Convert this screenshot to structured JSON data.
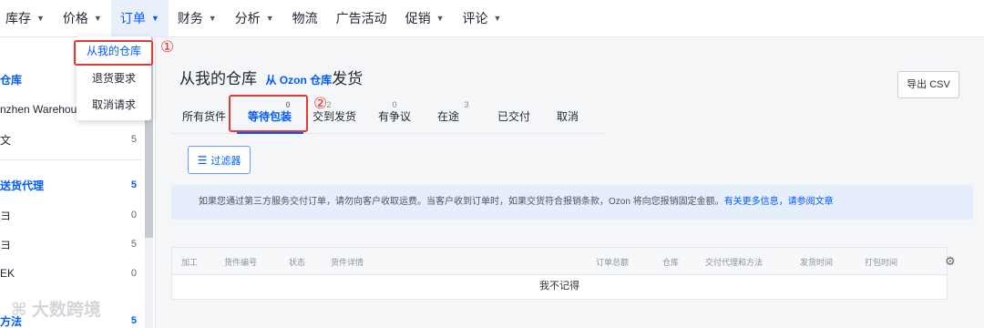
{
  "nav": {
    "items": [
      {
        "label": "库存",
        "has_menu": true
      },
      {
        "label": "价格",
        "has_menu": true
      },
      {
        "label": "订单",
        "has_menu": true,
        "active": true
      },
      {
        "label": "财务",
        "has_menu": true
      },
      {
        "label": "分析",
        "has_menu": true
      },
      {
        "label": "物流",
        "has_menu": false
      },
      {
        "label": "广告活动",
        "has_menu": false
      },
      {
        "label": "促销",
        "has_menu": true
      },
      {
        "label": "评论",
        "has_menu": true
      }
    ]
  },
  "dropdown": {
    "items": [
      "从我的仓库",
      "退货要求",
      "取消请求"
    ],
    "selected_index": 0
  },
  "annotations": {
    "marker1": "①",
    "marker2": "②"
  },
  "sidebar": {
    "rows": [
      {
        "label": "仓库",
        "count": "",
        "style": "blue"
      },
      {
        "label": "nzhen Warehouse",
        "count": "",
        "style": "normal"
      },
      {
        "label": "文",
        "count": "5",
        "style": "normal"
      },
      {
        "label": "送货代理",
        "count": "5",
        "style": "blue"
      },
      {
        "label": "ヨ",
        "count": "0",
        "style": "normal"
      },
      {
        "label": "ヨ",
        "count": "5",
        "style": "normal"
      },
      {
        "label": "EK",
        "count": "0",
        "style": "normal"
      },
      {
        "label": "方法",
        "count": "5",
        "style": "blue"
      }
    ]
  },
  "main": {
    "title_prefix": "从我的仓库",
    "title_link": "从 Ozon 仓库",
    "title_suffix": "发货",
    "export_label": "导出 CSV",
    "tabs": [
      {
        "label": "所有货件",
        "count": ""
      },
      {
        "label": "等待包装",
        "count": "0",
        "active": true
      },
      {
        "label": "交到发货",
        "count": "2"
      },
      {
        "label": "有争议",
        "count": "0"
      },
      {
        "label": "在途",
        "count": "3"
      },
      {
        "label": "已交付",
        "count": ""
      },
      {
        "label": "取消",
        "count": ""
      }
    ],
    "filter_label": "过滤器",
    "info_text": "如果您通过第三方服务交付订单，请勿向客户收取运费。当客户收到订单时，如果交货符合报销条款，Ozon 将向您报销固定金额。",
    "info_link": "有关更多信息，请参阅文章",
    "table": {
      "headers": [
        "加工",
        "货件编号",
        "状态",
        "货件详情",
        "订单总额",
        "仓库",
        "交付代理和方法",
        "发货时间",
        "打包时间"
      ],
      "empty_text": "我不记得"
    }
  },
  "watermark": "大数跨境",
  "colors": {
    "accent": "#005bff",
    "highlight": "#e53935",
    "info_bg": "#e6eefc"
  }
}
